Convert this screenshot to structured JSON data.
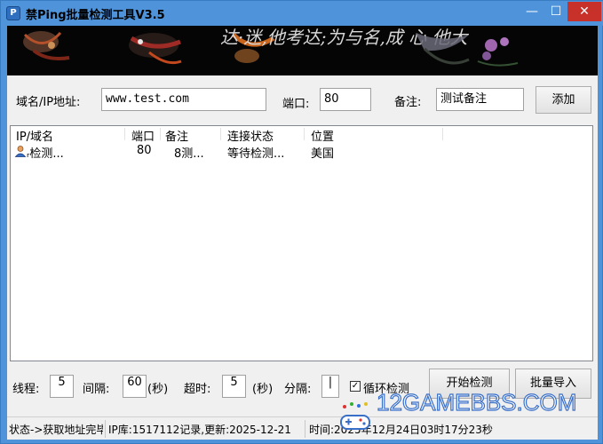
{
  "window": {
    "title": "禁Ping批量检测工具V3.5",
    "app_icon": "P",
    "minimize": "—",
    "maximize": "☐",
    "close": "✕"
  },
  "banner": {
    "calligraphy": "达·迷,他考达;为与名,成 心 他大"
  },
  "form": {
    "host_label": "域名/IP地址:",
    "host_value": "www.test.com",
    "port_label": "端口:",
    "port_value": "80",
    "note_label": "备注:",
    "note_value": "测试备注",
    "add_button": "添加"
  },
  "list": {
    "columns": [
      "IP/域名",
      "端口",
      "备注",
      "连接状态",
      "位置"
    ],
    "rows": [
      {
        "host": "ᵣ检测...",
        "port": "80",
        "note": "8测...",
        "status": "等待检测...",
        "location": "美国"
      }
    ]
  },
  "controls": {
    "threads_label": "线程:",
    "threads_value": "5",
    "interval_label": "间隔:",
    "interval_value": "60",
    "interval_unit": "(秒)",
    "timeout_label": "超时:",
    "timeout_value": "5",
    "timeout_unit": "(秒)",
    "divider_label": "分隔:",
    "divider_value": "|",
    "loop_label": "循环检测",
    "loop_checked": "✓",
    "start_button": "开始检测",
    "import_button": "批量导入"
  },
  "status": {
    "state": "状态->获取地址完毕",
    "ipdb": "IP库:1517112记录,更新:2025-12-21",
    "time": "时间:2025年12月24日03时17分23秒"
  },
  "watermark": {
    "text": "12GAMEBBS.COM"
  },
  "colors": {
    "titlebar": "#4f94da",
    "close_button": "#c7312a",
    "banner": "#050505",
    "watermark_stroke": "#3a6fc8"
  }
}
